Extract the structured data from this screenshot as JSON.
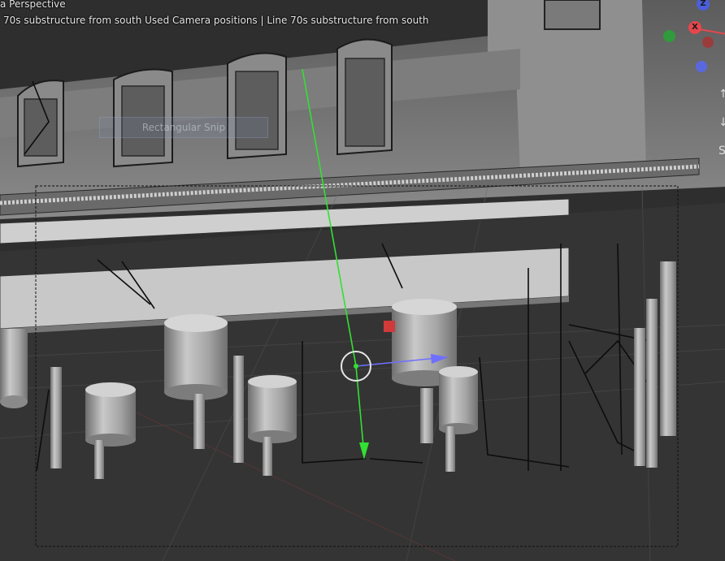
{
  "viewport": {
    "view_mode": "a Perspective",
    "scene_info": "70s substructure from south Used Camera positions | Line 70s substructure from south",
    "snip_overlay": "Rectangular Snip",
    "camera_frame": "dashed"
  },
  "gizmo": {
    "z_label": "Z",
    "x_label": "X",
    "colors": {
      "x": "#e5474d",
      "y": "#2f9b3c",
      "z": "#4b5fdc",
      "x_neg": "#9b3c3c",
      "z_neg": "#5a68e0"
    }
  },
  "nav": {
    "partial_glyphs": [
      "↑",
      "↓",
      "S"
    ]
  },
  "transform_widget": {
    "x_color": "#6f6fff",
    "y_color": "#33e033",
    "z_color": "#d03a3a",
    "object_selected": true
  },
  "colors": {
    "background": "#2e2e2e",
    "building": "#8e8e8e",
    "columns": "#b9b9b9",
    "grid": "#6a6a6a"
  }
}
